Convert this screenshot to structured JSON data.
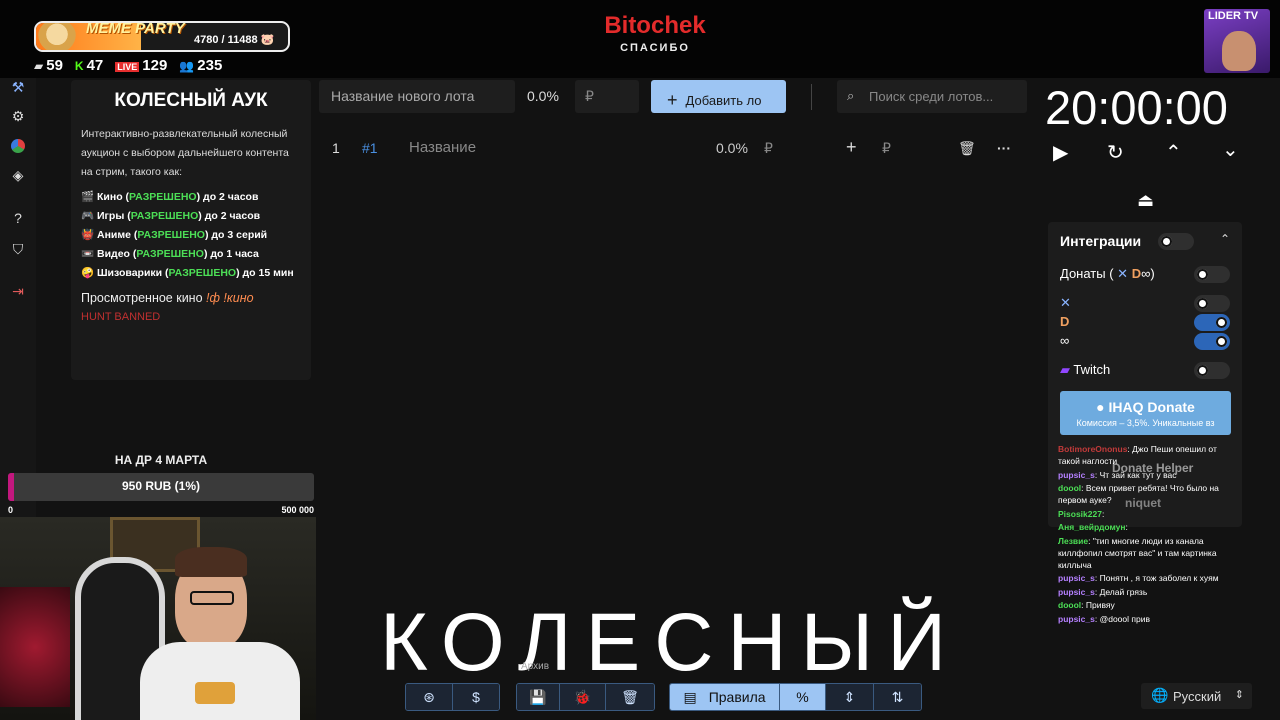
{
  "meme": {
    "title": "MEME PARTY",
    "count": "4780 / 11488",
    "progress": 0.416,
    "pig_icon": "pig-icon"
  },
  "stats": [
    {
      "icon": "twitch-icon",
      "value": "59"
    },
    {
      "icon": "kick-icon",
      "value": "47"
    },
    {
      "icon": "vk-live-icon",
      "value": "129"
    },
    {
      "icon": "viewers-icon",
      "value": "235"
    }
  ],
  "brand": {
    "name": "Bitochek",
    "sub": "СПАСИБО"
  },
  "channel_badge": "LIDER TV",
  "rules": {
    "title": "КОЛЕСНЫЙ АУК",
    "intro": "Интерактивно-развлекательный колесный аукцион с выбором дальнейшего контента на стрим, такого как:",
    "items": [
      {
        "pre": "Кино (",
        "allowed": "РАЗРЕШЕНО",
        "post": ") до 2 часов"
      },
      {
        "pre": "Игры (",
        "allowed": "РАЗРЕШЕНО",
        "post": ") до 2 часов"
      },
      {
        "pre": "Аниме (",
        "allowed": "РАЗРЕШЕНО",
        "post": ") до 3 серий"
      },
      {
        "pre": "Видео (",
        "allowed": "РАЗРЕШЕНО",
        "post": ") до 1 часа"
      },
      {
        "pre": "Шизоварики (",
        "allowed": "РАЗРЕШЕНО",
        "post": ") до 15 мин"
      }
    ],
    "watched": "Просмотренное кино",
    "watched_cmd": "!ф !кино",
    "hunt": "HUNT BANNED"
  },
  "goal": {
    "title": "НА ДР 4 МАРТА",
    "text": "950 RUB (1%)",
    "min": "0",
    "max": "500 000",
    "progress": 0.019
  },
  "toolbar": {
    "lot_placeholder": "Название нового лота",
    "percent": "0.0%",
    "currency": "₽",
    "add_label": "Добавить ло",
    "search_placeholder": "Поиск среди лотов..."
  },
  "lot": {
    "index": "1",
    "id": "#1",
    "name": "Название",
    "percent": "0.0%",
    "currency": "₽",
    "plus": "+",
    "amount_currency": "₽",
    "more": "···"
  },
  "timer": {
    "time": "20:00:00"
  },
  "integrations": {
    "title": "Интеграции",
    "donations": "Донаты (",
    "donations_end": ")",
    "twitch": "Twitch",
    "ihaq_title": "IHAQ Donate",
    "ihaq_sub": "Комиссия – 3,5%. Уникальные вз",
    "helper_overlay": "Donate Helper",
    "niquet_overlay": "niquet"
  },
  "chat": [
    {
      "name": "BotimoreOnonus",
      "color": "#c23a3a",
      "text": "Джо Пеши опешил от такой наглости"
    },
    {
      "name": "pupsic_s",
      "color": "#b580ff",
      "text": "Чт зай как тут у вас"
    },
    {
      "name": "doool",
      "color": "#4cdf56",
      "text": "Всем привет ребята! Что было на первом ауке?"
    },
    {
      "name": "Pisosik227",
      "color": "#4cdf56",
      "text": ""
    },
    {
      "name": "Аня_вейрдомун",
      "color": "#4cdf56",
      "text": ""
    },
    {
      "name": "Лезвие",
      "color": "#4cdf56",
      "text": "\"тип многие люди из канала киллфопил смотрят вас\" и там картинка киллыча"
    },
    {
      "name": "pupsic_s",
      "color": "#b580ff",
      "text": "Понятн , я тож заболел к хуям"
    },
    {
      "name": "pupsic_s",
      "color": "#b580ff",
      "text": "Делай грязь"
    },
    {
      "name": "doool",
      "color": "#4cdf56",
      "text": "Привяу"
    },
    {
      "name": "pupsic_s",
      "color": "#b580ff",
      "text": "@doool прив"
    }
  ],
  "watermark": "КОЛЕСНЫЙ",
  "bottom": {
    "archive_tooltip": "Архив",
    "rules_label": "Правила",
    "percent_icon": "%"
  },
  "language": {
    "selected": "Русский"
  },
  "colors": {
    "accent": "#9dc5f3",
    "toggle_on": "#2c66b8",
    "allowed": "#4cdf56",
    "brand_red": "#e32b2b"
  }
}
